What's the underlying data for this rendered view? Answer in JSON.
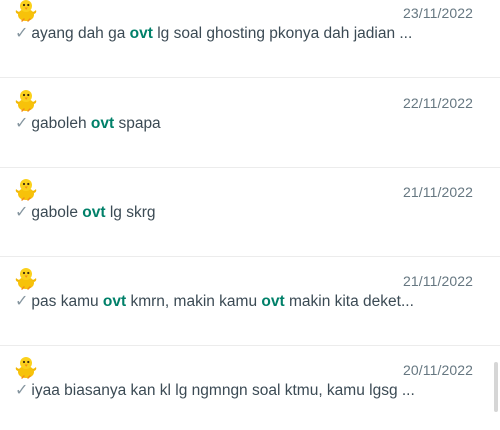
{
  "results": [
    {
      "date": "23/11/2022",
      "segments": [
        {
          "text": "ayang dah ga ",
          "hl": false
        },
        {
          "text": "ovt",
          "hl": true
        },
        {
          "text": " lg soal ghosting pkonya dah jadian ...",
          "hl": false
        }
      ]
    },
    {
      "date": "22/11/2022",
      "segments": [
        {
          "text": "gaboleh ",
          "hl": false
        },
        {
          "text": "ovt",
          "hl": true
        },
        {
          "text": " spapa",
          "hl": false
        }
      ]
    },
    {
      "date": "21/11/2022",
      "segments": [
        {
          "text": "gabole ",
          "hl": false
        },
        {
          "text": "ovt",
          "hl": true
        },
        {
          "text": " lg skrg",
          "hl": false
        }
      ]
    },
    {
      "date": "21/11/2022",
      "segments": [
        {
          "text": "pas kamu ",
          "hl": false
        },
        {
          "text": "ovt",
          "hl": true
        },
        {
          "text": " kmrn, makin kamu ",
          "hl": false
        },
        {
          "text": "ovt",
          "hl": true
        },
        {
          "text": " makin kita deket...",
          "hl": false
        }
      ]
    },
    {
      "date": "20/11/2022",
      "segments": [
        {
          "text": "iyaa biasanya kan kl lg ngmngn soal ktmu, kamu lgsg ...",
          "hl": false
        }
      ]
    }
  ],
  "check_glyph": "✓",
  "avatar_icon": "baby-chick-icon",
  "colors": {
    "highlight": "#008069",
    "date": "#667781",
    "message": "#3b4a54",
    "check": "#8696a0"
  }
}
